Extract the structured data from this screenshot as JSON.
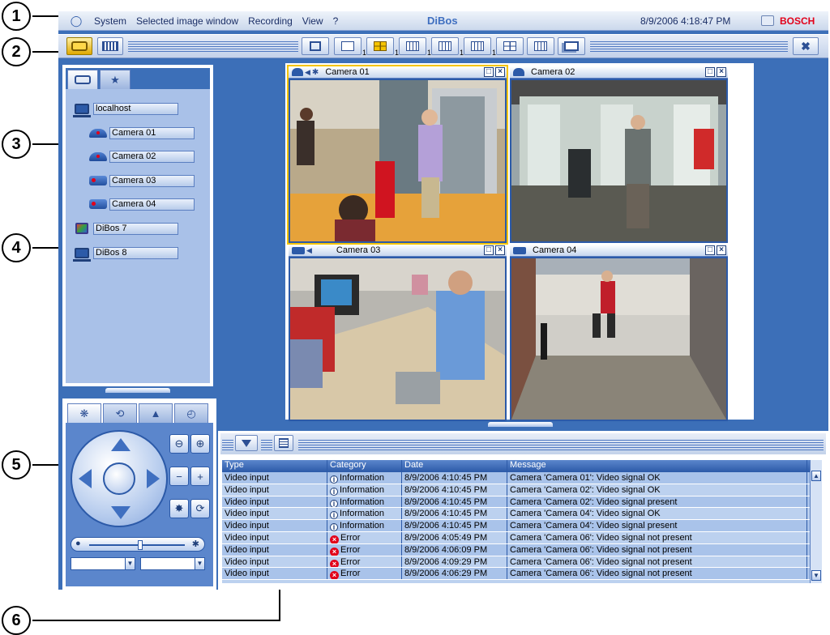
{
  "callouts": [
    "1",
    "2",
    "3",
    "4",
    "5",
    "6"
  ],
  "menubar": {
    "items": [
      "System",
      "Selected image window",
      "Recording",
      "View",
      "?"
    ],
    "title": "DiBos",
    "datetime": "8/9/2006 4:18:47 PM",
    "brand": "BOSCH"
  },
  "toolbar": {
    "layout_buttons": [
      {
        "icon": "fullscreen-icon",
        "sub": ""
      },
      {
        "icon": "single-view-icon",
        "sub": "1"
      },
      {
        "icon": "quad-view-icon",
        "sub": "1"
      },
      {
        "icon": "grid-3x3-icon",
        "sub": "1"
      },
      {
        "icon": "grid-4x4-icon",
        "sub": "1"
      },
      {
        "icon": "grid-5x5-icon",
        "sub": "1"
      }
    ]
  },
  "device_tree": {
    "items": [
      {
        "label": "localhost",
        "icon": "server-icon",
        "level": 0
      },
      {
        "label": "Camera 01",
        "icon": "dome-camera-icon",
        "level": 1
      },
      {
        "label": "Camera 02",
        "icon": "dome-camera-icon",
        "level": 1
      },
      {
        "label": "Camera 03",
        "icon": "box-camera-icon",
        "level": 1
      },
      {
        "label": "Camera 04",
        "icon": "box-camera-icon",
        "level": 1
      },
      {
        "label": "DiBos 7",
        "icon": "dibos-icon",
        "level": 0
      },
      {
        "label": "DiBos 8",
        "icon": "server-icon",
        "level": 0
      }
    ]
  },
  "video_tiles": [
    {
      "label": "Camera 01",
      "selected": true
    },
    {
      "label": "Camera 02",
      "selected": false
    },
    {
      "label": "Camera 03",
      "selected": false
    },
    {
      "label": "Camera 04",
      "selected": false
    }
  ],
  "log": {
    "columns": [
      "Type",
      "Category",
      "Date",
      "Message"
    ],
    "rows": [
      {
        "type": "Video input",
        "category": "Information",
        "severity": "info",
        "date": "8/9/2006 4:10:45 PM",
        "message": "Camera 'Camera 01': Video signal OK"
      },
      {
        "type": "Video input",
        "category": "Information",
        "severity": "info",
        "date": "8/9/2006 4:10:45 PM",
        "message": "Camera 'Camera 02': Video signal OK"
      },
      {
        "type": "Video input",
        "category": "Information",
        "severity": "info",
        "date": "8/9/2006 4:10:45 PM",
        "message": "Camera 'Camera 02': Video signal present"
      },
      {
        "type": "Video input",
        "category": "Information",
        "severity": "info",
        "date": "8/9/2006 4:10:45 PM",
        "message": "Camera 'Camera 04': Video signal OK"
      },
      {
        "type": "Video input",
        "category": "Information",
        "severity": "info",
        "date": "8/9/2006 4:10:45 PM",
        "message": "Camera 'Camera 04': Video signal present"
      },
      {
        "type": "Video input",
        "category": "Error",
        "severity": "error",
        "date": "8/9/2006 4:05:49 PM",
        "message": "Camera 'Camera 06': Video signal not present"
      },
      {
        "type": "Video input",
        "category": "Error",
        "severity": "error",
        "date": "8/9/2006 4:06:09 PM",
        "message": "Camera 'Camera 06': Video signal not present"
      },
      {
        "type": "Video input",
        "category": "Error",
        "severity": "error",
        "date": "8/9/2006 4:09:29 PM",
        "message": "Camera 'Camera 06': Video signal not present"
      },
      {
        "type": "Video input",
        "category": "Error",
        "severity": "error",
        "date": "8/9/2006 4:06:29 PM",
        "message": "Camera 'Camera 06': Video signal not present"
      }
    ]
  },
  "colors": {
    "app_background": "#3c6fb8",
    "selection": "#f5c400",
    "brand": "#e2001a",
    "error": "#e2001a"
  }
}
